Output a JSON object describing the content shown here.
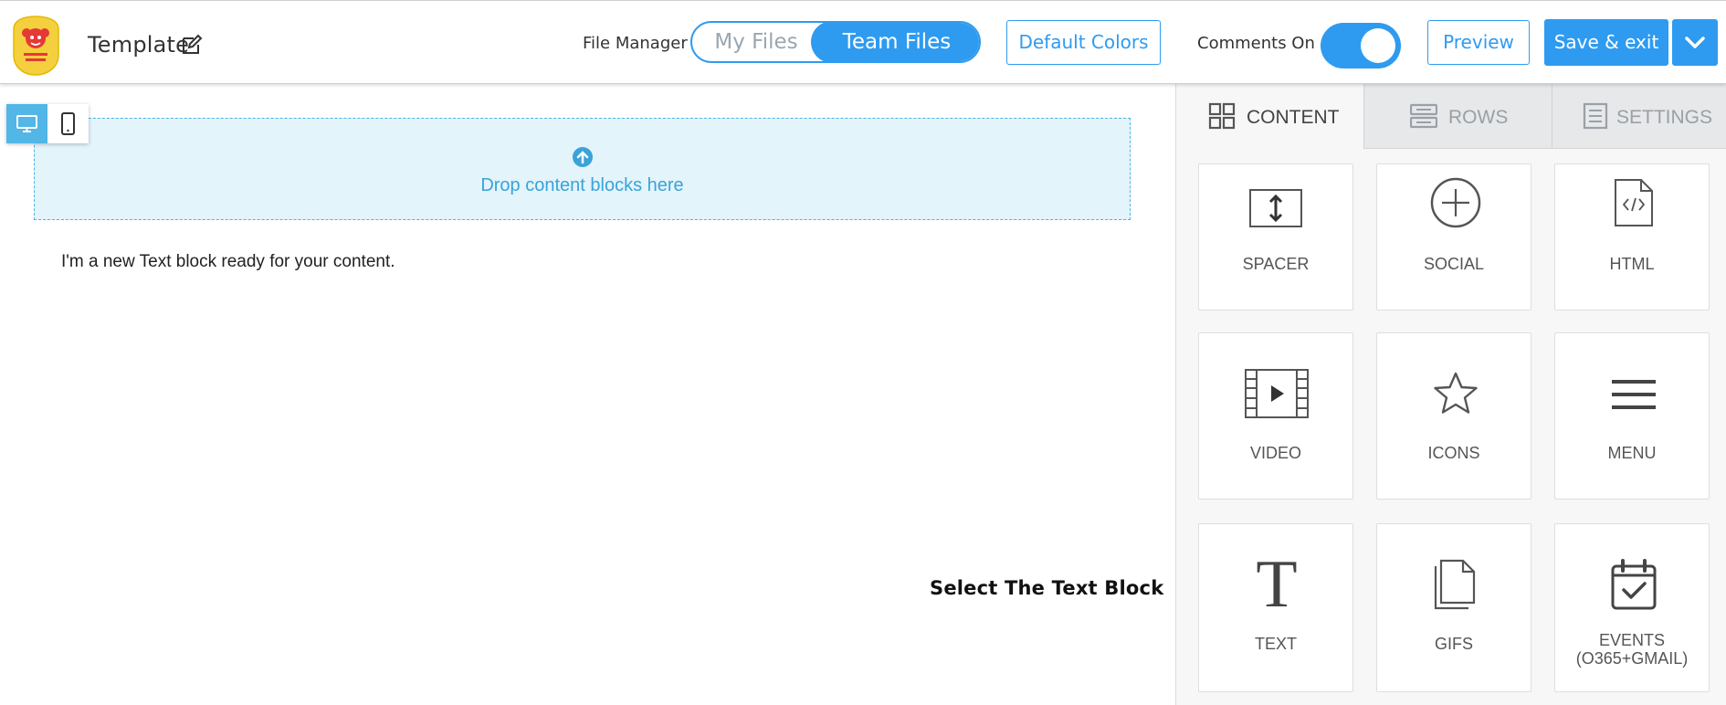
{
  "header": {
    "title": "Template",
    "file_manager_label": "File Manager",
    "file_tabs": {
      "my_files": "My Files",
      "team_files": "Team Files",
      "selected": "Team Files"
    },
    "default_colors_label": "Default Colors",
    "comments_label": "Comments On",
    "comments_enabled": true,
    "preview_label": "Preview",
    "save_exit_label": "Save & exit"
  },
  "canvas": {
    "drop_text": "Drop content blocks here",
    "text_block": "I'm a new Text block ready for your content.",
    "hint": "Select The Text Block",
    "device_selected": "desktop"
  },
  "panel": {
    "tabs": [
      {
        "label": "CONTENT",
        "icon": "grid-icon",
        "active": true
      },
      {
        "label": "ROWS",
        "icon": "rows-icon",
        "active": false
      },
      {
        "label": "SETTINGS",
        "icon": "settings-icon",
        "active": false
      }
    ],
    "blocks": [
      {
        "label": "SPACER",
        "icon": "spacer-icon"
      },
      {
        "label": "SOCIAL",
        "icon": "plus-circle-icon"
      },
      {
        "label": "HTML",
        "icon": "code-file-icon"
      },
      {
        "label": "VIDEO",
        "icon": "film-icon"
      },
      {
        "label": "ICONS",
        "icon": "star-icon"
      },
      {
        "label": "MENU",
        "icon": "menu-icon"
      },
      {
        "label": "TEXT",
        "icon": "text-t-icon"
      },
      {
        "label": "GIFS",
        "icon": "files-icon"
      },
      {
        "label": "EVENTS (O365+GMAIL)",
        "icon": "calendar-check-icon"
      }
    ]
  },
  "colors": {
    "accent": "#2e9bf0",
    "dropzone_bg": "#e3f4fb",
    "device_active": "#52b6e6"
  }
}
